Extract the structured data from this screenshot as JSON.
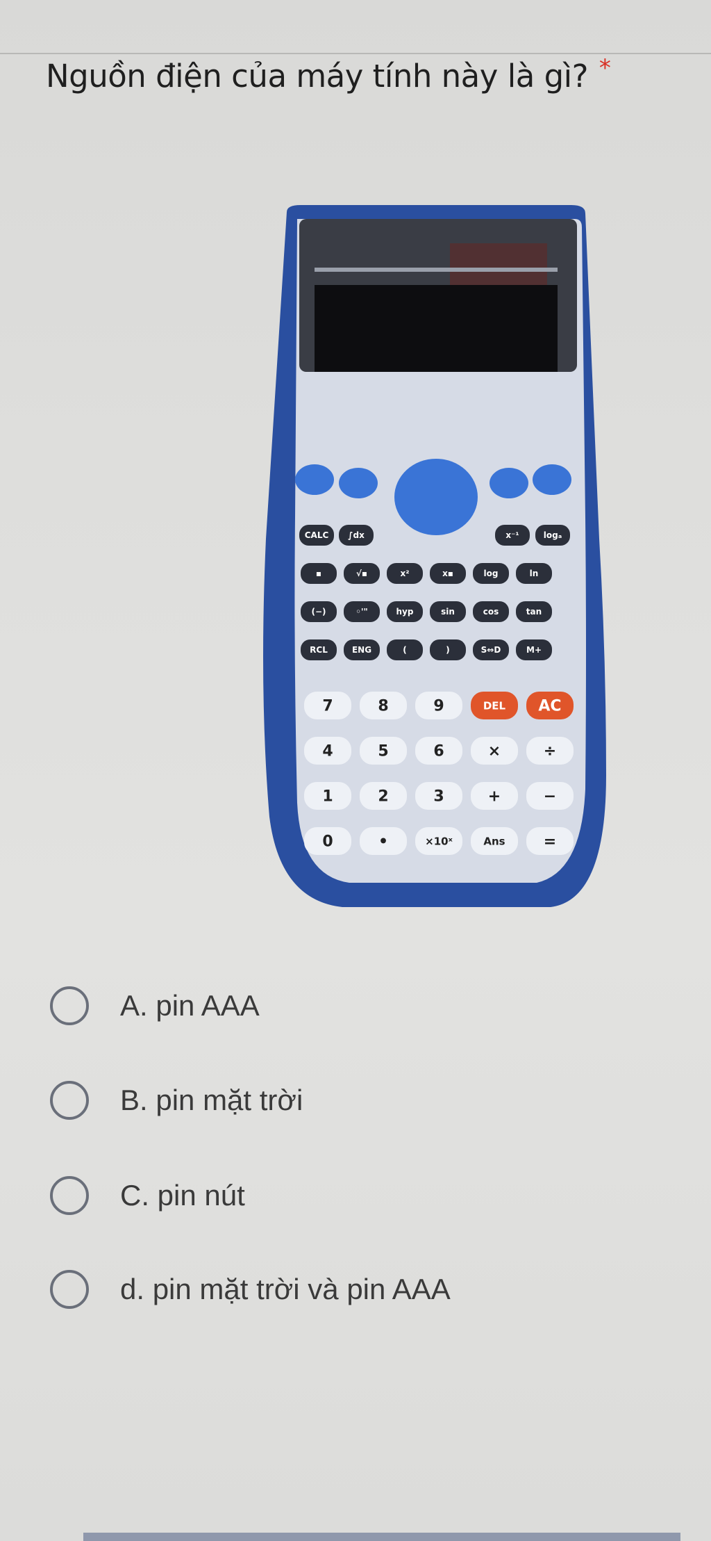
{
  "question": {
    "text": "Nguồn điện của máy tính này là gì?",
    "required_marker": "*"
  },
  "calculator": {
    "keys_row1": [
      "CALC",
      "∫dx"
    ],
    "keys_row1_right": [
      "x⁻¹",
      "logₐ"
    ],
    "keys_row2": [
      "▪",
      "√▪",
      "x²",
      "x▪",
      "log",
      "ln"
    ],
    "keys_row3": [
      "(−)",
      "◦'\"",
      "hyp",
      "sin",
      "cos",
      "tan"
    ],
    "keys_row4": [
      "RCL",
      "ENG",
      "(",
      ")",
      "S⇔D",
      "M+"
    ],
    "keys_row5": [
      "7",
      "8",
      "9",
      "DEL",
      "AC"
    ],
    "keys_row6": [
      "4",
      "5",
      "6",
      "×",
      "÷"
    ],
    "keys_row7": [
      "1",
      "2",
      "3",
      "+",
      "−"
    ],
    "keys_row8": [
      "0",
      "•",
      "×10ˣ",
      "Ans",
      "="
    ]
  },
  "options": [
    {
      "label": "A. pin AAA"
    },
    {
      "label": "B. pin mặt trời"
    },
    {
      "label": "C. pin nút"
    },
    {
      "label": "d. pin mặt trời và pin AAA"
    }
  ],
  "colors": {
    "calc_body": "#2a4fa0",
    "calc_face": "#d6dbe6",
    "dark_key": "#2b2f3a",
    "orange_key": "#e0552a",
    "blue_key": "#3a74d6"
  }
}
